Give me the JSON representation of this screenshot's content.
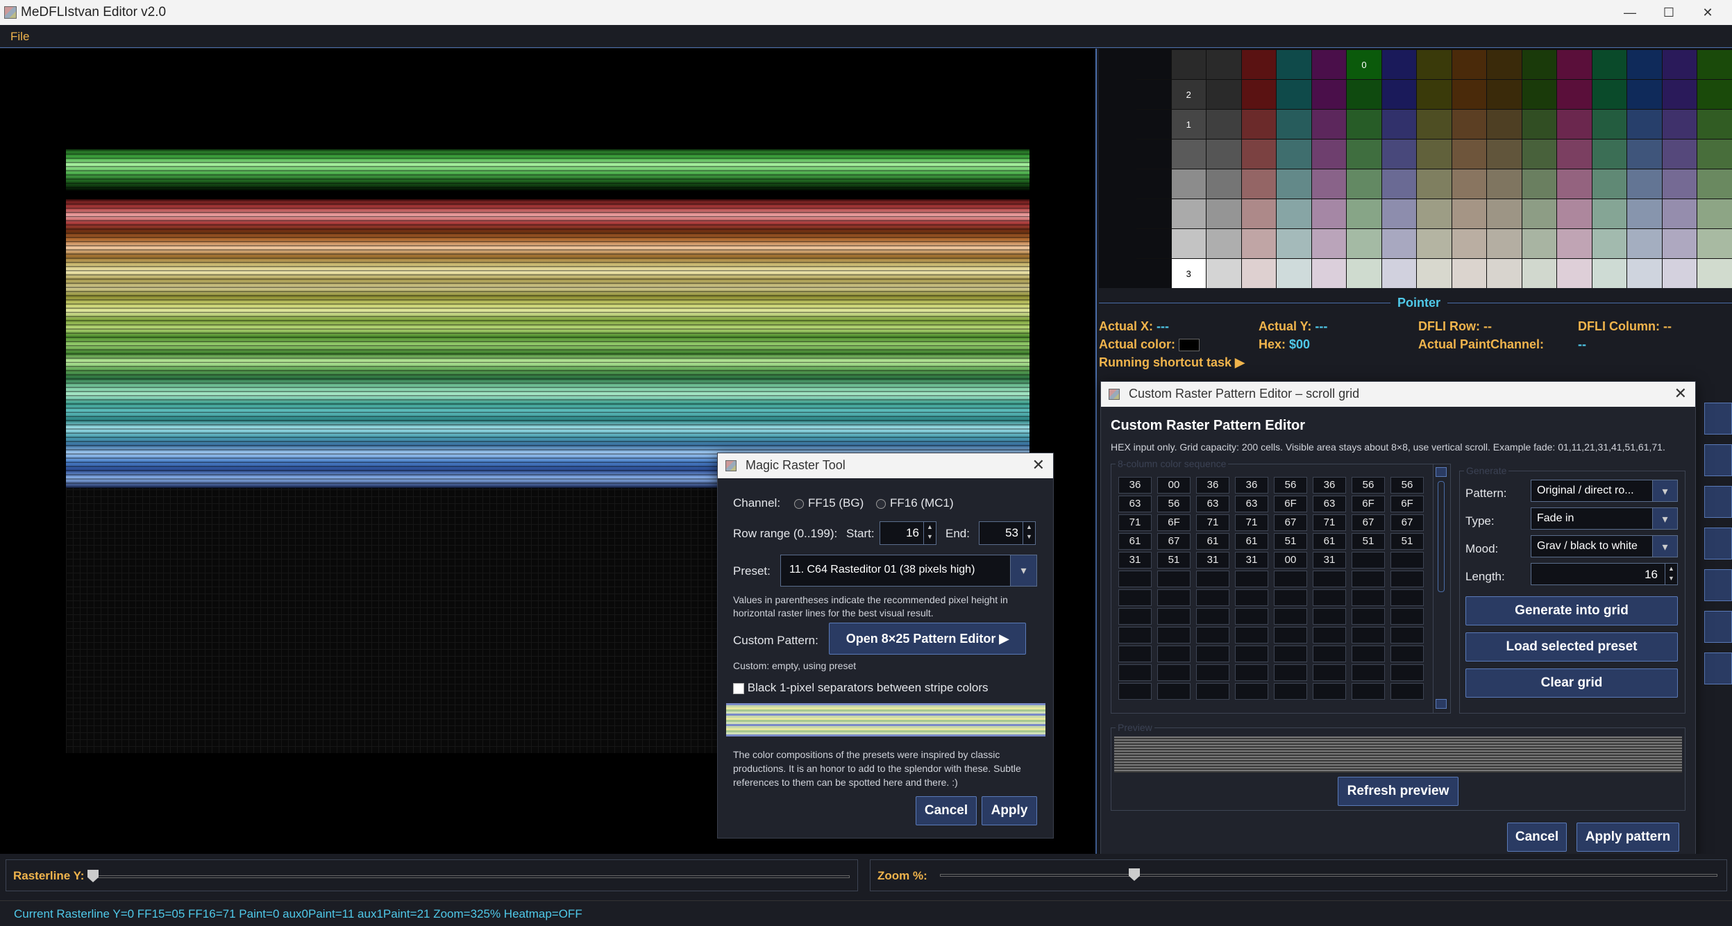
{
  "app": {
    "title": "MeDFLIstvan Editor v2.0"
  },
  "window_controls": {
    "minimize": "—",
    "maximize": "☐",
    "close": "✕"
  },
  "menu": {
    "file": "File"
  },
  "palette_grid": {
    "markers": [
      "0",
      "2",
      "1",
      "3"
    ]
  },
  "pointer": {
    "title": "Pointer",
    "actual_x_label": "Actual X:",
    "actual_x_value": "---",
    "actual_y_label": "Actual Y:",
    "actual_y_value": "---",
    "dfli_row_label": "DFLI Row:",
    "dfli_row_value": "--",
    "dfli_col_label": "DFLI Column:",
    "dfli_col_value": "--",
    "actual_color_label": "Actual color:",
    "hex_label": "Hex:",
    "hex_value": "$00",
    "paint_channel_label": "Actual PaintChannel:",
    "paint_channel_value": "--",
    "shortcut_task": "Running shortcut task ▶"
  },
  "magic_raster": {
    "title": "Magic Raster Tool",
    "channel_label": "Channel:",
    "channel_opt1": "FF15 (BG)",
    "channel_opt2": "FF16 (MC1)",
    "row_range_label": "Row range (0..199):",
    "start_label": "Start:",
    "start_value": "16",
    "end_label": "End:",
    "end_value": "53",
    "preset_label": "Preset:",
    "preset_value": "11. C64 Rasteditor 01 (38 pixels high)",
    "note": "Values in parentheses indicate the recommended pixel height in horizontal raster lines for the best visual result.",
    "custom_pattern_label": "Custom Pattern:",
    "open_editor_button": "Open 8×25 Pattern Editor  ▶",
    "custom_status": "Custom: empty, using preset",
    "separator_label": "Black 1-pixel separators between stripe colors",
    "credits": "The color compositions of the presets were inspired by classic productions. It is an honor to add to the splendor with these. Subtle references to them can be spotted here and there. :)",
    "cancel_button": "Cancel",
    "apply_button": "Apply"
  },
  "pattern_editor": {
    "window_title": "Custom Raster Pattern Editor – scroll grid",
    "heading": "Custom Raster Pattern Editor",
    "info": "HEX input only. Grid capacity: 200 cells. Visible area stays about 8×8, use vertical scroll. Example fade: 01,11,21,31,41,51,61,71.",
    "sequence_group": "8-column color sequence",
    "cells": [
      "36",
      "00",
      "36",
      "36",
      "56",
      "36",
      "56",
      "56",
      "63",
      "56",
      "63",
      "63",
      "6F",
      "63",
      "6F",
      "6F",
      "71",
      "6F",
      "71",
      "71",
      "67",
      "71",
      "67",
      "67",
      "61",
      "67",
      "61",
      "61",
      "51",
      "61",
      "51",
      "51",
      "31",
      "51",
      "31",
      "31",
      "00",
      "31",
      "",
      "",
      "",
      "",
      "",
      "",
      "",
      "",
      "",
      "",
      "",
      "",
      "",
      "",
      "",
      "",
      "",
      "",
      "",
      "",
      "",
      "",
      "",
      "",
      "",
      "",
      "",
      "",
      "",
      "",
      "",
      "",
      "",
      "",
      "",
      "",
      "",
      "",
      "",
      "",
      "",
      "",
      "",
      "",
      "",
      "",
      "",
      "",
      "",
      "",
      "",
      "",
      "",
      "",
      "",
      "",
      "",
      ""
    ],
    "generate_group": "Generate",
    "pattern_label": "Pattern:",
    "pattern_value": "Original / direct ro...",
    "type_label": "Type:",
    "type_value": "Fade in",
    "mood_label": "Mood:",
    "mood_value": "Grav / black to white",
    "length_label": "Length:",
    "length_value": "16",
    "generate_button": "Generate into grid",
    "load_preset_button": "Load selected preset",
    "clear_button": "Clear grid",
    "preview_group": "Preview",
    "refresh_button": "Refresh preview",
    "cancel_button": "Cancel",
    "apply_button": "Apply pattern"
  },
  "bottom": {
    "rasterline_label": "Rasterline Y:",
    "zoom_label": "Zoom %:",
    "rasterline_position": 0,
    "zoom_percent": 325
  },
  "status": {
    "text": "Current Rasterline Y=0  FF15=05  FF16=71  Paint=0  aux0Paint=11  aux1Paint=21  Zoom=325%  Heatmap=OFF"
  },
  "colors": {
    "accent_orange": "#f0b44c",
    "accent_cyan": "#4fc8e8",
    "button_blue": "#2a3b63"
  }
}
